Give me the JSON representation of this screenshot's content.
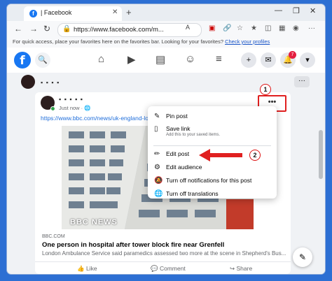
{
  "browser": {
    "tab_title": "| Facebook",
    "tab_close": "✕",
    "new_tab": "+",
    "window_controls": [
      "—",
      "❐",
      "✕"
    ],
    "url": "https://www.facebook.com/m...",
    "url_aa": "A",
    "favbar_text": "For quick access, place your favorites here on the favorites bar. Looking for your favorites?",
    "favbar_link": "Check your profiles"
  },
  "facebook": {
    "logo": "f",
    "notification_count": "7"
  },
  "group": {
    "name_blurred": "▪︎ ▪︎ ▪︎ ▪︎"
  },
  "post": {
    "author_blurred": "▪︎ ▪︎ ▪︎ ▪︎ ▪︎",
    "time": "Just now · ",
    "link": "https://www.bbc.com/news/uk-england-londo",
    "image_watermark": "BBC NEWS",
    "source": "BBC.COM",
    "title": "One person in hospital after tower block fire near Grenfell",
    "description": "London Ambulance Service said paramedics assessed two more at the scene in Shepherd's Bus...",
    "actions": {
      "like": "Like",
      "comment": "Comment",
      "share": "Share"
    },
    "more_button": "•••"
  },
  "menu": {
    "items": [
      {
        "label": "Pin post",
        "sub": "",
        "icon": "pin-icon",
        "glyph": "✎"
      },
      {
        "label": "Save link",
        "sub": "Add this to your saved items.",
        "icon": "bookmark-icon",
        "glyph": "▯"
      },
      {
        "label": "Edit post",
        "sub": "",
        "icon": "pencil-icon",
        "glyph": "✏"
      },
      {
        "label": "Edit audience",
        "sub": "",
        "icon": "gear-icon",
        "glyph": "⚙"
      },
      {
        "label": "Turn off notifications for this post",
        "sub": "",
        "icon": "bell-off-icon",
        "glyph": "🔕"
      },
      {
        "label": "Turn off translations",
        "sub": "",
        "icon": "globe-icon",
        "glyph": "🌐"
      }
    ]
  },
  "annotations": {
    "step1": "1",
    "step2": "2",
    "color": "#e02020"
  }
}
